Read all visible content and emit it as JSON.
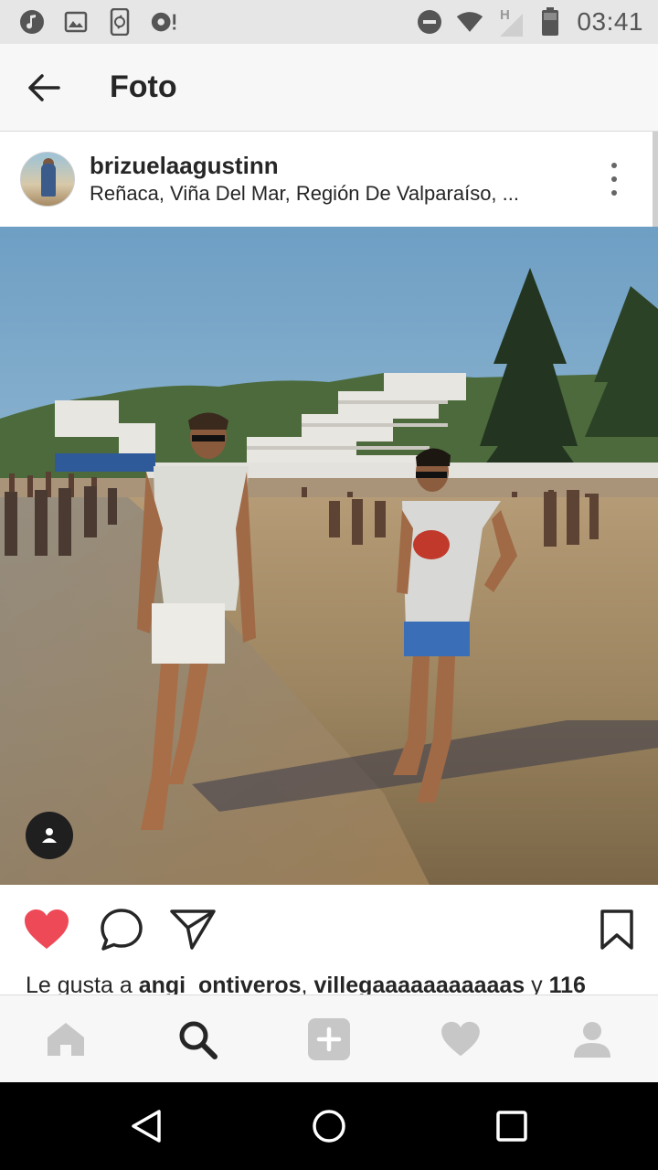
{
  "status_bar": {
    "time": "03:41",
    "icons_left": [
      "music-note-icon",
      "image-icon",
      "phone-sync-icon",
      "alarm-icon"
    ],
    "icons_right": [
      "do-not-disturb-icon",
      "wifi-icon",
      "network-h-icon",
      "battery-icon"
    ]
  },
  "header": {
    "back_icon": "arrow-left-icon",
    "title": "Foto"
  },
  "post": {
    "username": "brizuelaagustinn",
    "location": "Reñaca, Viña Del Mar, Región De Valparaíso, ...",
    "more_icon": "vertical-ellipsis-icon",
    "photo": "two young men standing barefoot on a crowded sandy beach in front of hillside apartment buildings and tall pine trees",
    "tag_icon": "person-tag-icon"
  },
  "actions": {
    "like_icon": "heart-filled-icon",
    "comment_icon": "comment-bubble-icon",
    "share_icon": "paper-plane-icon",
    "save_icon": "bookmark-icon",
    "liked": true
  },
  "likes": {
    "prefix": "Le gusta a ",
    "user1": "angi_ontiveros",
    "separator": ", ",
    "user2": "villegaaaaaaaaaaas",
    "conjunction": " y ",
    "count": "116"
  },
  "tabbar": {
    "items": [
      "home-icon",
      "search-icon",
      "add-post-icon",
      "activity-heart-icon",
      "profile-icon"
    ],
    "active": "search-icon"
  },
  "navbar": {
    "items": [
      "back-triangle-icon",
      "home-circle-icon",
      "recents-square-icon"
    ]
  },
  "colors": {
    "like_red": "#ed4956",
    "text": "#262626",
    "status_bar_bg": "#e6e6e6",
    "bar_bg": "#f7f7f7"
  }
}
